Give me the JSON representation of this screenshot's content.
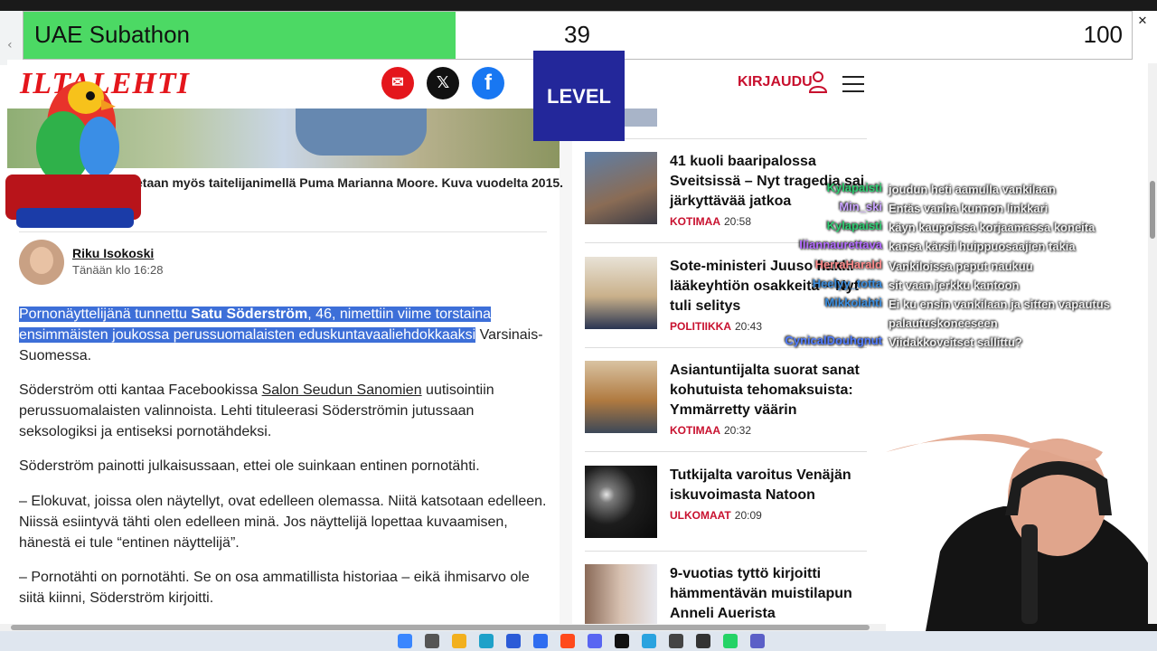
{
  "subathon": {
    "title": "UAE Subathon",
    "current": "39",
    "goal": "100",
    "progress": 0.39
  },
  "site": {
    "logo": "ILTALEHTI",
    "login": "KIRJAUDU",
    "overlay_logo": "LEVEL"
  },
  "article": {
    "caption": "etaan myös taitelijanimellä Puma Marianna Moore. Kuva vuodelta 2015.",
    "author": "Riku Isokoski",
    "time": "Tänään klo 16:28",
    "p1_sel_a": "Pornonäyttelijänä tunnettu ",
    "p1_sel_bold": "Satu Söderström",
    "p1_sel_b": ", 46, nimettiin viime torstaina ensimmäisten joukossa perussuomalaisten eduskuntavaaliehdokkaaksi",
    "p1_rest": " Varsinais-Suomessa.",
    "p2_a": "Söderström otti kantaa Facebookissa ",
    "p2_link": "Salon Seudun Sanomien",
    "p2_b": " uutisointiin perussuomalaisten valinnoista. Lehti tituleerasi Söderströmin jutussaan seksologiksi ja entiseksi pornotähdeksi.",
    "p3": "Söderström painotti julkaisussaan, ettei ole suinkaan entinen pornotähti.",
    "p4": "– Elokuvat, joissa olen näytellyt, ovat edelleen olemassa. Niitä katsotaan edelleen. Niissä esiintyvä tähti olen edelleen minä. Jos näyttelijä lopettaa kuvaamisen, hänestä ei tule “entinen näyttelijä”.",
    "p5": "– Pornotähti on pornotähti. Se on osa ammatillista historiaa – eikä ihmisarvo ole siitä kiinni, Söderström kirjoitti."
  },
  "news": [
    {
      "title": "41 kuoli baaripalossa Sveitsissä – Nyt tragedia sai järkyttävää jatkoa",
      "category": "KOTIMAA",
      "time": "20:58"
    },
    {
      "title": "Sote-ministeri Juuso hakki lääkeyhtiön osakkeita – Nyt tuli selitys",
      "category": "POLITIIKKA",
      "time": "20:43"
    },
    {
      "title": "Asiantuntijalta suorat sanat kohutuista tehomaksuista: Ymmärretty väärin",
      "category": "KOTIMAA",
      "time": "20:32"
    },
    {
      "title": "Tutkijalta varoitus Venäjän iskuvoimasta Natoon",
      "category": "ULKOMAAT",
      "time": "20:09"
    },
    {
      "title": "9-vuotias tyttö kirjoitti hämmentävän muistilapun Anneli Auerista",
      "category": "",
      "time": ""
    }
  ],
  "chat": [
    {
      "user": "Kylapaisti",
      "color": "#2ecc71",
      "message": "joudun heti aamulla vankilaan"
    },
    {
      "user": "Min_ski",
      "color": "#c9a3ff",
      "message": "Entäs vanha kunnon linkkari"
    },
    {
      "user": "Kylapaisti",
      "color": "#2ecc71",
      "message": "käyn kaupoissa korjaamassa koneita"
    },
    {
      "user": "Iliannaurettava",
      "color": "#b36bff",
      "message": "kansa kärsii huippuosaajien takia"
    },
    {
      "user": "HerraHarald",
      "color": "#ff8a8a",
      "message": "Vankiloissa peput naukuu"
    },
    {
      "user": "Heelyy_totta",
      "color": "#3a8dde",
      "message": "sit vaan jerkku kantoon"
    },
    {
      "user": "Mikkolahti",
      "color": "#3a8dde",
      "message": "Ei ku ensin vankilaan ja sitten vapautus palautuskoneeseen"
    },
    {
      "user": "CynicalDouhgnut",
      "color": "#4f7bff",
      "message": "Viidakkoveitset sallittu?"
    }
  ],
  "colors": {
    "accent": "#c8102e",
    "selection": "#3d6fd8",
    "subathon_fill": "#4cd964"
  }
}
